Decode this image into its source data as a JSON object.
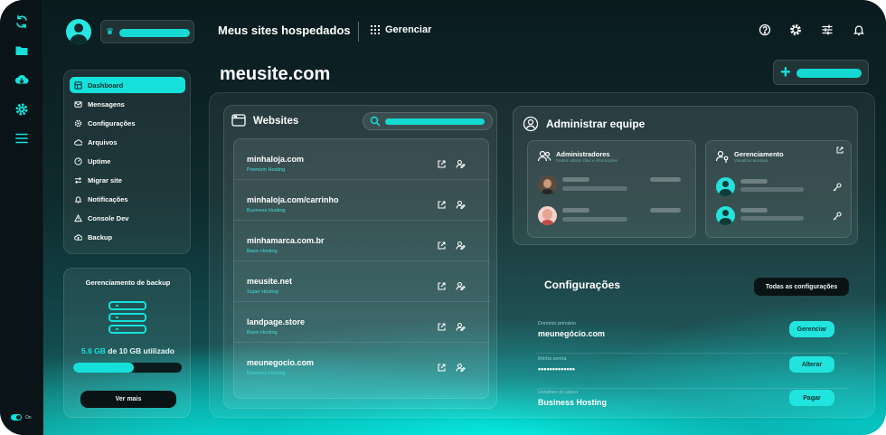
{
  "header": {
    "title": "Meus sites hospedados",
    "manage_label": "Gerenciar"
  },
  "page": {
    "title": "meusite.com"
  },
  "sidebar": {
    "items": [
      {
        "label": "Dashboard",
        "icon": "dashboard-icon",
        "active": true
      },
      {
        "label": "Mensagens",
        "icon": "mail-icon"
      },
      {
        "label": "Configurações",
        "icon": "gear-icon"
      },
      {
        "label": "Arquivos",
        "icon": "cloud-icon"
      },
      {
        "label": "Uptime",
        "icon": "gauge-icon"
      },
      {
        "label": "Migrar site",
        "icon": "swap-icon"
      },
      {
        "label": "Notificações",
        "icon": "bell-icon"
      },
      {
        "label": "Console Dev",
        "icon": "warning-icon"
      },
      {
        "label": "Backup",
        "icon": "cloud-upload-icon"
      }
    ]
  },
  "backup": {
    "title": "Gerenciamento de backup",
    "used": "5.6 GB",
    "rest": " de 10 GB utilizado",
    "progress": 0.56,
    "button": "Ver mais"
  },
  "websites": {
    "title": "Websites",
    "items": [
      {
        "domain": "minhaloja.com",
        "plan": "Premium Hosting"
      },
      {
        "domain": "minhaloja.com/carrinho",
        "plan": "Business Hosting"
      },
      {
        "domain": "minhamarca.com.br",
        "plan": "Basic Hosting"
      },
      {
        "domain": "meusite.net",
        "plan": "Super Hosting"
      },
      {
        "domain": "landpage.store",
        "plan": "Basic Hosting"
      },
      {
        "domain": "meunegocio.com",
        "plan": "Business Hosting"
      }
    ]
  },
  "team": {
    "title": "Administrar equipe",
    "admins": {
      "title": "Administradores",
      "subtitle": "Podem alterar sites e informações"
    },
    "management": {
      "title": "Gerenciamento",
      "subtitle": "Visualizar acessos"
    }
  },
  "settings": {
    "title": "Configurações",
    "all_button": "Todas as configurações",
    "rows": [
      {
        "label": "Domínio primário",
        "value": "meunegócio.com",
        "button": "Gerenciar"
      },
      {
        "label": "Minha senha",
        "value": "•••••••••••••",
        "button": "Alterar"
      },
      {
        "label": "Detalhes do plano",
        "value": "Business Hosting",
        "button": "Pagar"
      }
    ]
  },
  "footer": {
    "toggle_label": "On"
  },
  "colors": {
    "accent": "#15e0da",
    "dark": "#0a1416"
  }
}
